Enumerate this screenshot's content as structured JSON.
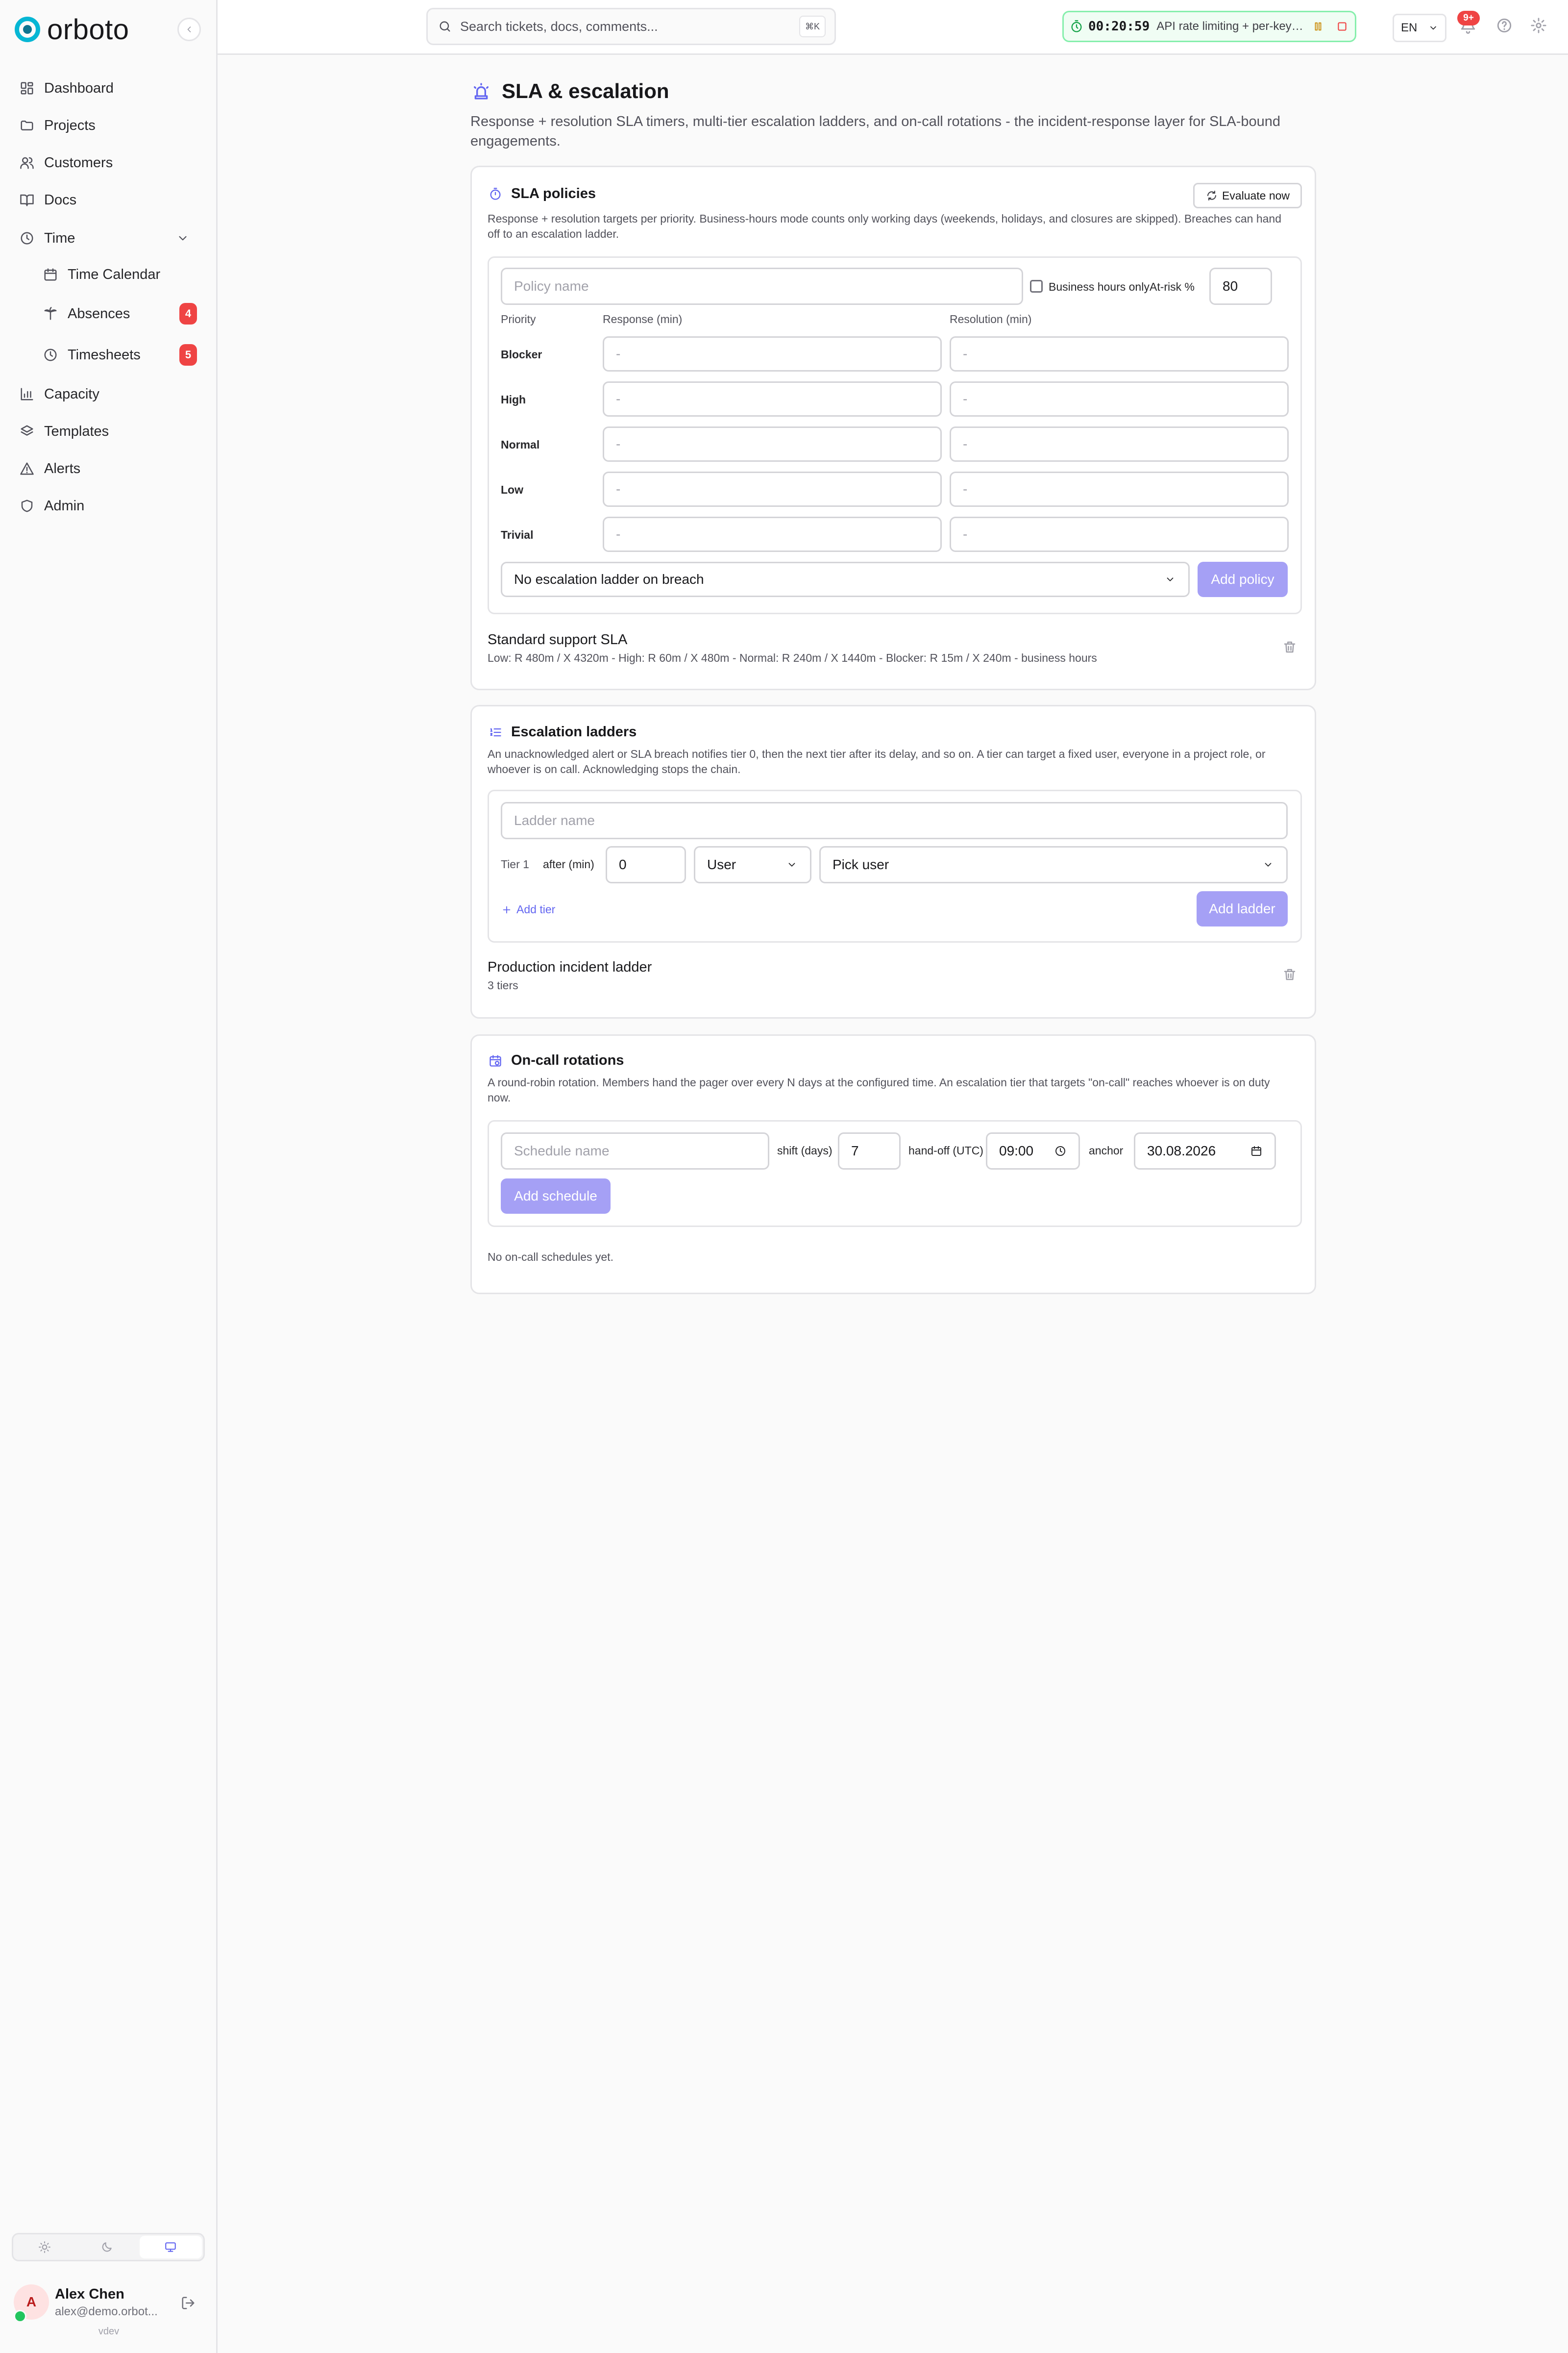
{
  "app": {
    "brand": "orboto",
    "version": "vdev"
  },
  "sidebar": {
    "items": [
      {
        "label": "Dashboard",
        "icon": "dashboard-icon"
      },
      {
        "label": "Projects",
        "icon": "folder-icon"
      },
      {
        "label": "Customers",
        "icon": "users-icon"
      },
      {
        "label": "Docs",
        "icon": "book-icon"
      },
      {
        "label": "Time",
        "icon": "clock-icon"
      },
      {
        "label": "Time Calendar",
        "icon": "calendar-icon"
      },
      {
        "label": "Absences",
        "icon": "palm-tree-icon",
        "badge": "4"
      },
      {
        "label": "Timesheets",
        "icon": "clock-icon",
        "badge": "5"
      },
      {
        "label": "Capacity",
        "icon": "bar-chart-icon"
      },
      {
        "label": "Templates",
        "icon": "layers-icon"
      },
      {
        "label": "Alerts",
        "icon": "warning-icon"
      },
      {
        "label": "Admin",
        "icon": "shield-icon"
      }
    ]
  },
  "user": {
    "initial": "A",
    "name": "Alex Chen",
    "email": "alex@demo.orbot..."
  },
  "topbar": {
    "search_placeholder": "Search tickets, docs, comments...",
    "search_shortcut": "⌘K",
    "timer": {
      "time": "00:20:59",
      "task": "API rate limiting + per-key ..."
    },
    "language": "EN",
    "notifications_badge": "9+"
  },
  "page": {
    "title": "SLA & escalation",
    "description": "Response + resolution SLA timers, multi-tier escalation ladders, and on-call rotations - the incident-response layer for SLA-bound engagements."
  },
  "sla": {
    "title": "SLA policies",
    "evaluate_label": "Evaluate now",
    "description": "Response + resolution targets per priority. Business-hours mode counts only working days (weekends, holidays, and closures are skipped). Breaches can hand off to an escalation ladder.",
    "policy_name_placeholder": "Policy name",
    "business_hours_label": "Business hours only",
    "at_risk_label": "At-risk %",
    "at_risk_value": "80",
    "col_priority": "Priority",
    "col_response": "Response (min)",
    "col_resolution": "Resolution (min)",
    "priorities": [
      {
        "name": "Blocker",
        "response": "-",
        "resolution": "-"
      },
      {
        "name": "High",
        "response": "-",
        "resolution": "-"
      },
      {
        "name": "Normal",
        "response": "-",
        "resolution": "-"
      },
      {
        "name": "Low",
        "response": "-",
        "resolution": "-"
      },
      {
        "name": "Trivial",
        "response": "-",
        "resolution": "-"
      }
    ],
    "ladder_select": "No escalation ladder on breach",
    "add_label": "Add policy",
    "policies": [
      {
        "name": "Standard support SLA",
        "summary": "Low: R 480m / X 4320m - High: R 60m / X 480m - Normal: R 240m / X 1440m - Blocker: R 15m / X 240m - business hours"
      }
    ]
  },
  "ladders": {
    "title": "Escalation ladders",
    "description": "An unacknowledged alert or SLA breach notifies tier 0, then the next tier after its delay, and so on. A tier can target a fixed user, everyone in a project role, or whoever is on call. Acknowledging stops the chain.",
    "name_placeholder": "Ladder name",
    "tier_label": "Tier 1",
    "after_label": "after (min)",
    "after_value": "0",
    "target_type": "User",
    "target_value": "Pick user",
    "add_tier_label": "Add tier",
    "add_label": "Add ladder",
    "items": [
      {
        "name": "Production incident ladder",
        "meta": "3 tiers"
      }
    ]
  },
  "oncall": {
    "title": "On-call rotations",
    "description": "A round-robin rotation. Members hand the pager over every N days at the configured time. An escalation tier that targets \"on-call\" reaches whoever is on duty now.",
    "name_placeholder": "Schedule name",
    "shift_label": "shift (days)",
    "shift_value": "7",
    "handoff_label": "hand-off (UTC)",
    "handoff_value": "09:00",
    "anchor_label": "anchor",
    "anchor_value": "30.08.2026",
    "add_label": "Add schedule",
    "empty": "No on-call schedules yet."
  },
  "colors": {
    "accent": "#6366f1",
    "accent_disabled": "#a5a0f5",
    "brand": "#06b6d4",
    "badge": "#ef4444",
    "timer_bg": "#f0fdf4"
  }
}
